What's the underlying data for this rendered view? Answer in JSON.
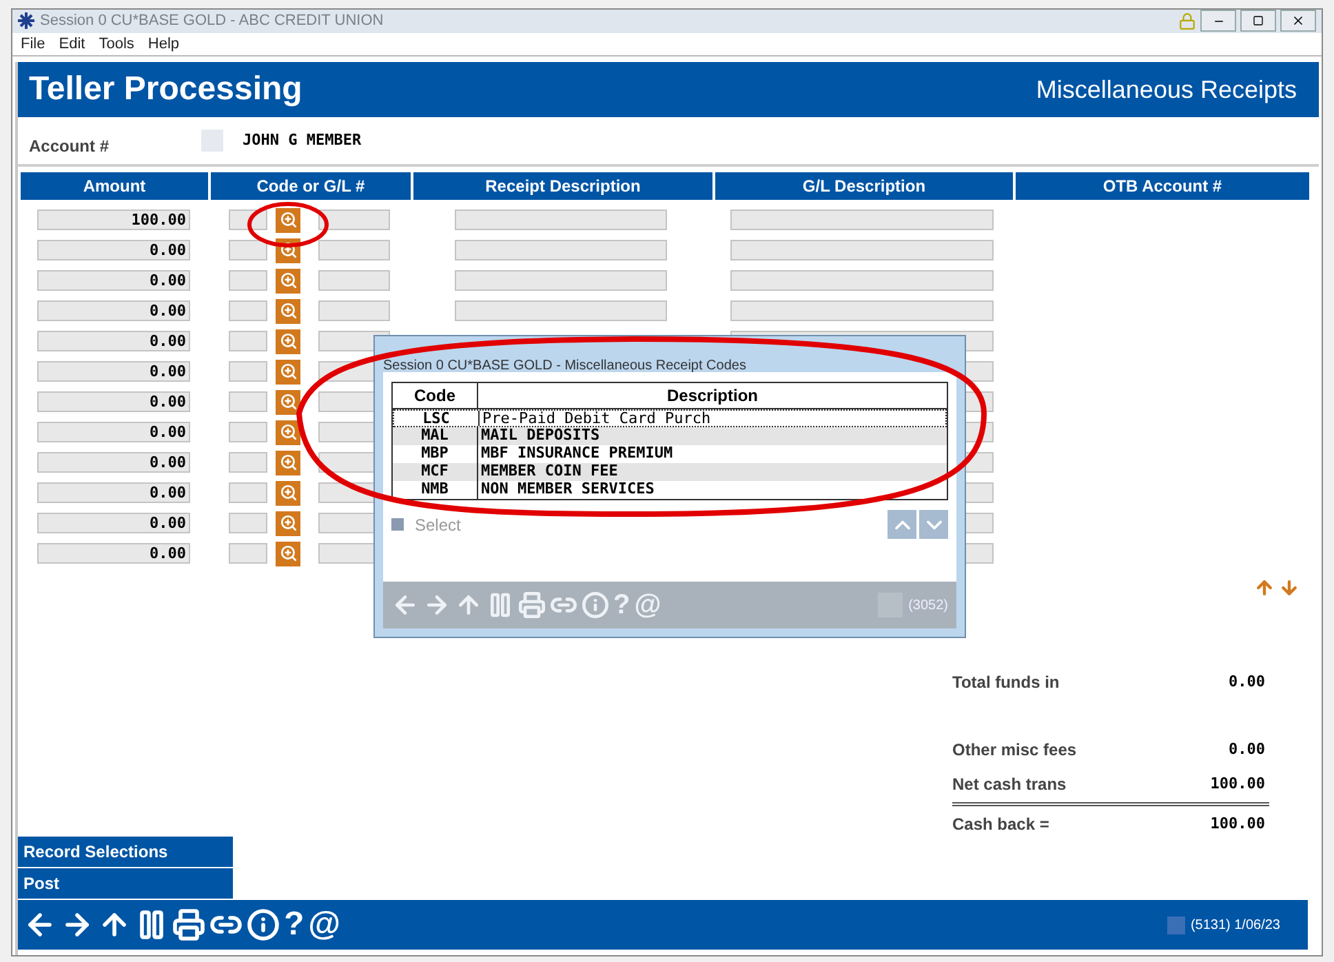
{
  "window": {
    "title": "Session 0 CU*BASE GOLD - ABC CREDIT UNION"
  },
  "menu": [
    "File",
    "Edit",
    "Tools",
    "Help"
  ],
  "header": {
    "title": "Teller Processing",
    "subtitle": "Miscellaneous Receipts"
  },
  "account": {
    "label": "Account #",
    "name": "JOHN G MEMBER"
  },
  "columns": [
    "Amount",
    "Code or G/L #",
    "Receipt Description",
    "G/L Description",
    "OTB Account #"
  ],
  "rows": [
    {
      "amount": "100.00"
    },
    {
      "amount": "0.00"
    },
    {
      "amount": "0.00"
    },
    {
      "amount": "0.00"
    },
    {
      "amount": "0.00"
    },
    {
      "amount": "0.00"
    },
    {
      "amount": "0.00"
    },
    {
      "amount": "0.00"
    },
    {
      "amount": "0.00"
    },
    {
      "amount": "0.00"
    },
    {
      "amount": "0.00"
    },
    {
      "amount": "0.00"
    }
  ],
  "totals": [
    {
      "kind": "plain",
      "label": "Total funds in",
      "value": "0.00"
    },
    {
      "kind": "spaced",
      "label": "Other misc fees",
      "value": "0.00"
    },
    {
      "kind": "plain",
      "label": "Net cash trans",
      "value": "100.00"
    },
    {
      "kind": "sum",
      "label": "Cash back =",
      "value": "100.00"
    }
  ],
  "actions": [
    "Record Selections",
    "Post"
  ],
  "toolbar_glyphs": [
    "?",
    "@"
  ],
  "status": "(5131) 1/06/23",
  "dialog": {
    "title": "Session 0 CU*BASE GOLD - Miscellaneous Receipt Codes",
    "columns": [
      "Code",
      "Description"
    ],
    "rows": [
      {
        "code": "LSC",
        "description": "Pre-Paid Debit Card Purch",
        "selected": true
      },
      {
        "code": "MAL",
        "description": "MAIL DEPOSITS",
        "selected": false
      },
      {
        "code": "MBP",
        "description": "MBF INSURANCE PREMIUM",
        "selected": false
      },
      {
        "code": "MCF",
        "description": "MEMBER COIN FEE",
        "selected": false
      },
      {
        "code": "NMB",
        "description": "NON MEMBER SERVICES",
        "selected": false
      }
    ],
    "select_label": "Select",
    "select_checked": false,
    "toolbar_glyphs": [
      "?",
      "@"
    ],
    "status": "(3052)"
  }
}
